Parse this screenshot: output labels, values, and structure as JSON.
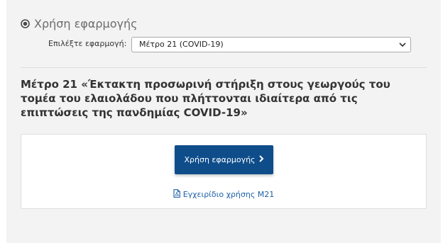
{
  "section": {
    "title": "Χρήση εφαρμογής",
    "icon": "radio-dot-icon"
  },
  "app_select": {
    "label": "Επιλέξτε εφαρμογή:",
    "selected": "Μέτρο 21 (COVID-19)"
  },
  "measure": {
    "heading": "Μέτρο 21 «Έκτακτη προσωρινή στήριξη στους γεωργούς του τομέα του ελαιολάδου που πλήττονται ιδιαίτερα από τις επιπτώσεις της πανδημίας COVID-19»"
  },
  "card": {
    "button_label": "Χρήση εφαρμογής",
    "button_icon": "chevron-right-icon",
    "manual_link": "Εγχειρίδιο χρήσης Μ21",
    "manual_icon": "pdf-file-icon"
  },
  "colors": {
    "primary": "#0e4d8a",
    "link": "#1d5fa5",
    "panel_bg": "#f3f3f3"
  }
}
